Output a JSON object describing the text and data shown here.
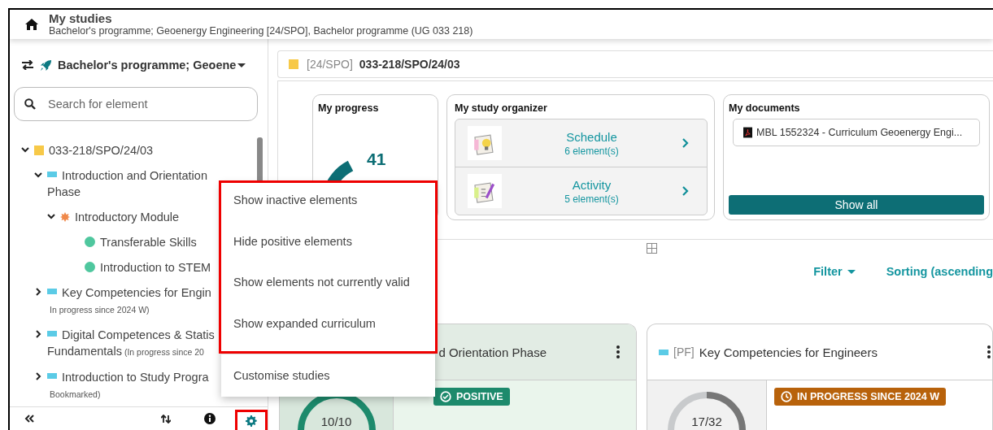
{
  "header": {
    "title": "My studies",
    "subtitle": "Bachelor's programme; Geoenergy Engineering [24/SPO], Bachelor programme (UG 033 218)"
  },
  "sidebar": {
    "programme": "Bachelor's programme; Geoene",
    "search": {
      "placeholder": "Search for element"
    },
    "tree": [
      {
        "kind": "folder",
        "color": "#f7c948",
        "lines": [
          "033-218/SPO/24/03"
        ],
        "expanded": true,
        "children": [
          {
            "kind": "phase",
            "color": "#5bcbe6",
            "lines": [
              "Introduction and Orientation",
              "Phase"
            ],
            "expanded": true,
            "children": [
              {
                "kind": "module",
                "color": "#f0894a",
                "lines": [
                  "Introductory Module"
                ],
                "expanded": true,
                "children": [
                  {
                    "kind": "course",
                    "color": "#4fc79e",
                    "lines": [
                      "Transferable Skills"
                    ]
                  },
                  {
                    "kind": "course",
                    "color": "#4fc79e",
                    "lines": [
                      "Introduction to STEM"
                    ]
                  }
                ]
              }
            ]
          },
          {
            "kind": "phase",
            "color": "#5bcbe6",
            "lines": [
              "Key Competencies for Engin"
            ],
            "expanded": false,
            "note": "In progress since 2024 W)",
            "note_below": true
          },
          {
            "kind": "phase",
            "color": "#5bcbe6",
            "lines": [
              "Digital Competences & Statis",
              "Fundamentals"
            ],
            "expanded": false,
            "note": "(In progress since 20",
            "note_below": false
          },
          {
            "kind": "phase",
            "color": "#5bcbe6",
            "lines": [
              "Introduction to Study Progra"
            ],
            "expanded": false,
            "note": "Bookmarked)",
            "note_below": true
          }
        ]
      }
    ],
    "tools": [
      {
        "kind": "collapse",
        "highlighted": false
      },
      {
        "kind": "sort",
        "highlighted": false
      },
      {
        "kind": "info",
        "highlighted": false
      },
      {
        "kind": "settings",
        "highlighted": true
      }
    ]
  },
  "breadcrumb": {
    "tag": "[24/SPO]",
    "code": "033-218/SPO/24/03"
  },
  "widgets": {
    "progress": {
      "title": "My progress",
      "value": "41"
    },
    "organizer": {
      "title": "My study organizer",
      "items": [
        {
          "kind": "schedule",
          "label": "Schedule",
          "count": "6 element(s)"
        },
        {
          "kind": "activity",
          "label": "Activity",
          "count": "5 element(s)"
        }
      ]
    },
    "documents": {
      "title": "My documents",
      "files": [
        "MBL 1552324 - Curriculum Geoenergy Engi..."
      ],
      "button": "Show all"
    }
  },
  "toolbar": {
    "filter": "Filter",
    "sorting": "Sorting (ascending"
  },
  "cards": [
    {
      "title": "d Orientation Phase",
      "ratio": "10/10",
      "status": {
        "kind": "positive",
        "label": "POSITIVE"
      }
    },
    {
      "tag": "[PF]",
      "title": "Key Competencies for Engineers",
      "ratio": "17/32",
      "status": {
        "kind": "in_progress",
        "label": "IN PROGRESS SINCE 2024 W"
      }
    }
  ],
  "menu": {
    "sections": [
      {
        "highlighted": true,
        "items": [
          "Show inactive elements",
          "Hide positive elements",
          "Show elements not currently valid",
          "Show expanded curriculum"
        ]
      },
      {
        "highlighted": false,
        "items": [
          "Customise studies"
        ]
      }
    ]
  }
}
